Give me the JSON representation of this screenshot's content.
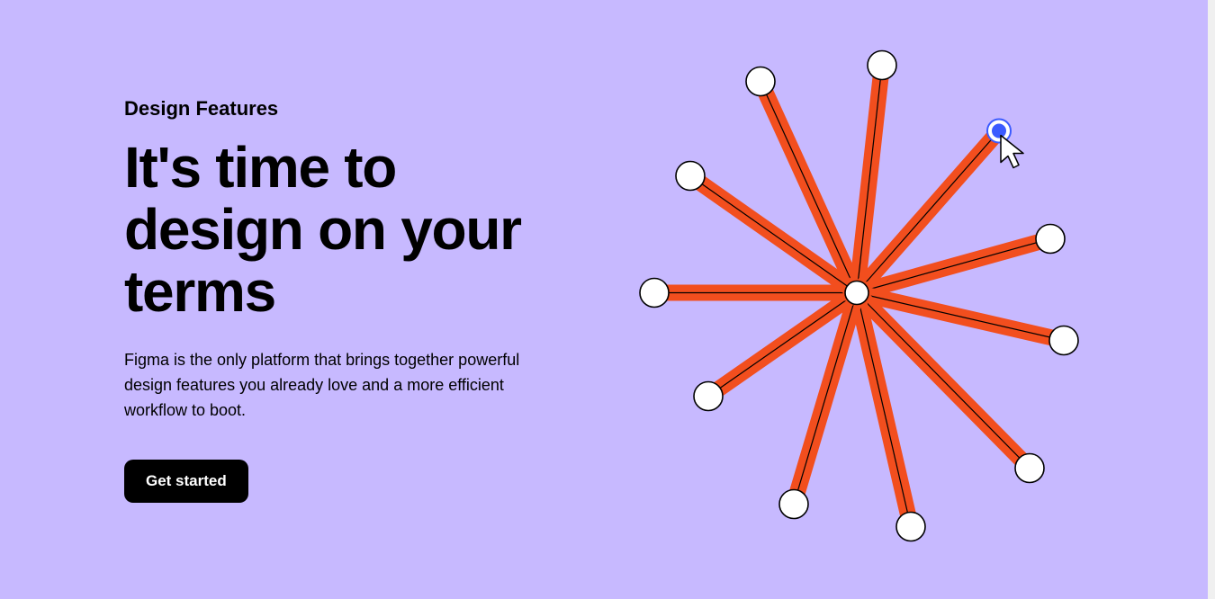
{
  "hero": {
    "eyebrow": "Design Features",
    "headline": "It's time to design on your terms",
    "subcopy": "Figma is the only platform that brings together powerful design features you already love and a more efficient workflow to boot.",
    "cta_label": "Get started"
  },
  "colors": {
    "background": "#c7b9ff",
    "spoke": "#f24e1e",
    "node_fill": "#ffffff",
    "node_stroke": "#000000",
    "selected_node": "#3b5bff",
    "cta_bg": "#000000",
    "cta_text": "#ffffff"
  }
}
